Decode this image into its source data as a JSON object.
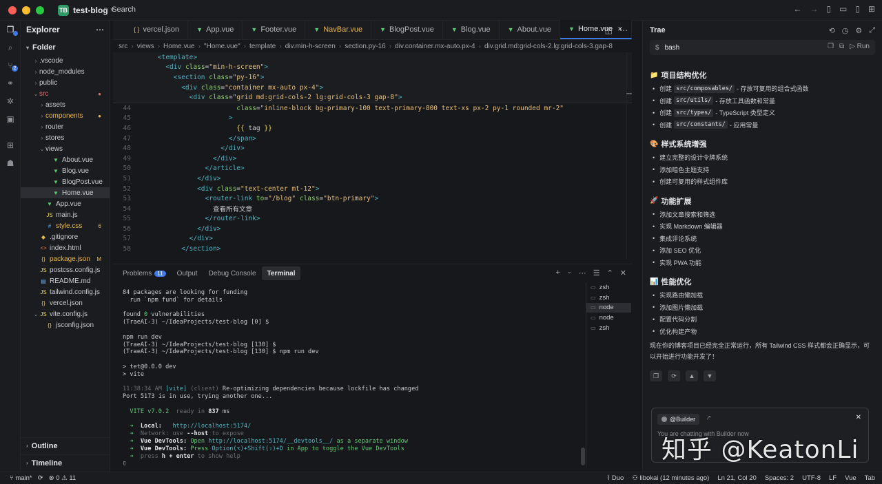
{
  "titlebar": {
    "badge": "TB",
    "project": "test-blog",
    "search_label": "Search"
  },
  "activity": {
    "scm_count": "2"
  },
  "explorer": {
    "title": "Explorer",
    "folder_title": "Folder",
    "tree": [
      {
        "label": ".vscode",
        "indent": 1,
        "type": "folder",
        "open": false
      },
      {
        "label": "node_modules",
        "indent": 1,
        "type": "folder",
        "open": false
      },
      {
        "label": "public",
        "indent": 1,
        "type": "folder",
        "open": false
      },
      {
        "label": "src",
        "indent": 1,
        "type": "folder",
        "open": true,
        "color": "#e66b6b",
        "badge": "●"
      },
      {
        "label": "assets",
        "indent": 2,
        "type": "folder",
        "open": false
      },
      {
        "label": "components",
        "indent": 2,
        "type": "folder",
        "open": false,
        "color": "#e8b84a",
        "badge": "●"
      },
      {
        "label": "router",
        "indent": 2,
        "type": "folder",
        "open": false
      },
      {
        "label": "stores",
        "indent": 2,
        "type": "folder",
        "open": false
      },
      {
        "label": "views",
        "indent": 2,
        "type": "folder",
        "open": true
      },
      {
        "label": "About.vue",
        "indent": 3,
        "type": "vue"
      },
      {
        "label": "Blog.vue",
        "indent": 3,
        "type": "vue"
      },
      {
        "label": "BlogPost.vue",
        "indent": 3,
        "type": "vue"
      },
      {
        "label": "Home.vue",
        "indent": 3,
        "type": "vue",
        "selected": true
      },
      {
        "label": "App.vue",
        "indent": 2,
        "type": "vue"
      },
      {
        "label": "main.js",
        "indent": 2,
        "type": "js"
      },
      {
        "label": "style.css",
        "indent": 2,
        "type": "css",
        "color": "#e8b84a",
        "badge": "6"
      },
      {
        "label": ".gitignore",
        "indent": 1,
        "type": "git"
      },
      {
        "label": "index.html",
        "indent": 1,
        "type": "html"
      },
      {
        "label": "package.json",
        "indent": 1,
        "type": "json",
        "color": "#e8b84a",
        "badge": "M"
      },
      {
        "label": "postcss.config.js",
        "indent": 1,
        "type": "js"
      },
      {
        "label": "README.md",
        "indent": 1,
        "type": "md"
      },
      {
        "label": "tailwind.config.js",
        "indent": 1,
        "type": "js"
      },
      {
        "label": "vercel.json",
        "indent": 1,
        "type": "json"
      },
      {
        "label": "vite.config.js",
        "indent": 1,
        "type": "js",
        "open": true,
        "chev": true
      },
      {
        "label": "jsconfig.json",
        "indent": 2,
        "type": "json"
      }
    ],
    "outline": "Outline",
    "timeline": "Timeline"
  },
  "editor": {
    "tabs": [
      {
        "label": "vercel.json",
        "icon": "{ }",
        "icon_color": "#e8c27a"
      },
      {
        "label": "App.vue",
        "icon": "▼",
        "icon_color": "#5ccc73"
      },
      {
        "label": "Footer.vue",
        "icon": "▼",
        "icon_color": "#5ccc73"
      },
      {
        "label": "NavBar.vue",
        "icon": "▼",
        "icon_color": "#5ccc73",
        "label_color": "#e8b84a"
      },
      {
        "label": "BlogPost.vue",
        "icon": "▼",
        "icon_color": "#5ccc73"
      },
      {
        "label": "Blog.vue",
        "icon": "▼",
        "icon_color": "#5ccc73"
      },
      {
        "label": "About.vue",
        "icon": "▼",
        "icon_color": "#5ccc73"
      },
      {
        "label": "Home.vue",
        "icon": "▼",
        "icon_color": "#5ccc73",
        "active": true
      }
    ],
    "breadcrumbs": [
      "src",
      "views",
      "Home.vue",
      "\"Home.vue\"",
      "template",
      "div.min-h-screen",
      "section.py-16",
      "div.container.mx-auto.px-4",
      "div.grid.md:grid-cols-2.lg:grid-cols-3.gap-8"
    ],
    "sticky_lines": [
      {
        "indent": 2,
        "parts": [
          [
            "tg",
            "<template>"
          ]
        ]
      },
      {
        "indent": 3,
        "parts": [
          [
            "tg",
            "<div "
          ],
          [
            "at",
            "class"
          ],
          [
            "pl",
            "="
          ],
          [
            "st",
            "\"min-h-screen\""
          ],
          [
            "tg",
            ">"
          ]
        ]
      },
      {
        "indent": 4,
        "parts": [
          [
            "tg",
            "<section "
          ],
          [
            "at",
            "class"
          ],
          [
            "pl",
            "="
          ],
          [
            "st",
            "\"py-16\""
          ],
          [
            "tg",
            ">"
          ]
        ]
      },
      {
        "indent": 5,
        "parts": [
          [
            "tg",
            "<div "
          ],
          [
            "at",
            "class"
          ],
          [
            "pl",
            "="
          ],
          [
            "st",
            "\"container mx-auto px-4\""
          ],
          [
            "tg",
            ">"
          ]
        ]
      },
      {
        "indent": 6,
        "parts": [
          [
            "tg",
            "<div "
          ],
          [
            "at",
            "class"
          ],
          [
            "pl",
            "="
          ],
          [
            "st",
            "\"grid md:grid-cols-2 lg:grid-cols-3 gap-8\""
          ],
          [
            "tg",
            ">"
          ]
        ]
      }
    ],
    "code_lines": [
      {
        "n": "44",
        "indent": 12,
        "parts": [
          [
            "at",
            "class"
          ],
          [
            "pl",
            "="
          ],
          [
            "st",
            "\"inline-block bg-primary-100 text-primary-800 text-xs px-2 py-1 rounded mr-2\""
          ]
        ]
      },
      {
        "n": "45",
        "indent": 11,
        "parts": [
          [
            "tg",
            ">"
          ]
        ]
      },
      {
        "n": "46",
        "indent": 12,
        "parts": [
          [
            "br",
            "{{ "
          ],
          [
            "pl",
            "tag"
          ],
          [
            "br",
            " }}"
          ]
        ]
      },
      {
        "n": "47",
        "indent": 11,
        "parts": [
          [
            "tg",
            "</span>"
          ]
        ]
      },
      {
        "n": "48",
        "indent": 10,
        "parts": [
          [
            "tg",
            "</div>"
          ]
        ]
      },
      {
        "n": "49",
        "indent": 9,
        "parts": [
          [
            "tg",
            "</div>"
          ]
        ]
      },
      {
        "n": "50",
        "indent": 8,
        "parts": [
          [
            "tg",
            "</article>"
          ]
        ]
      },
      {
        "n": "51",
        "indent": 7,
        "parts": [
          [
            "tg",
            "</div>"
          ]
        ]
      },
      {
        "n": "52",
        "indent": 7,
        "parts": [
          [
            "tg",
            "<div "
          ],
          [
            "at",
            "class"
          ],
          [
            "pl",
            "="
          ],
          [
            "st",
            "\"text-center mt-12\""
          ],
          [
            "tg",
            ">"
          ]
        ]
      },
      {
        "n": "53",
        "indent": 8,
        "parts": [
          [
            "tg",
            "<router-link "
          ],
          [
            "at",
            "to"
          ],
          [
            "pl",
            "="
          ],
          [
            "st",
            "\"/blog\" "
          ],
          [
            "at",
            "class"
          ],
          [
            "pl",
            "="
          ],
          [
            "st",
            "\"btn-primary\""
          ],
          [
            "tg",
            ">"
          ]
        ]
      },
      {
        "n": "54",
        "indent": 9,
        "parts": [
          [
            "pl",
            "查看所有文章"
          ]
        ]
      },
      {
        "n": "55",
        "indent": 8,
        "parts": [
          [
            "tg",
            "</router-link>"
          ]
        ]
      },
      {
        "n": "56",
        "indent": 7,
        "parts": [
          [
            "tg",
            "</div>"
          ]
        ]
      },
      {
        "n": "57",
        "indent": 6,
        "parts": [
          [
            "tg",
            "</div>"
          ]
        ]
      },
      {
        "n": "58",
        "indent": 5,
        "parts": [
          [
            "tg",
            "</section>"
          ]
        ]
      }
    ]
  },
  "panel": {
    "tabs": [
      "Problems",
      "Output",
      "Debug Console",
      "Terminal"
    ],
    "problems_count": "11",
    "sessions": [
      {
        "label": "zsh",
        "active": false
      },
      {
        "label": "zsh",
        "active": false
      },
      {
        "label": "node",
        "active": true
      },
      {
        "label": "node",
        "active": false
      },
      {
        "label": "zsh",
        "active": false
      }
    ],
    "terminal": [
      [
        [
          "",
          "84 packages are looking for funding"
        ]
      ],
      [
        [
          "",
          "  run `npm fund` for details"
        ]
      ],
      [
        [
          "",
          ""
        ]
      ],
      [
        [
          "",
          "found "
        ],
        [
          "green",
          "0"
        ],
        [
          "",
          " vulnerabilities"
        ]
      ],
      [
        [
          "",
          "(TraeAI-3) ~/IdeaProjects/test-blog [0] $"
        ]
      ],
      [
        [
          "",
          ""
        ]
      ],
      [
        [
          "",
          "npm run dev"
        ]
      ],
      [
        [
          "",
          "(TraeAI-3) ~/IdeaProjects/test-blog [130] $"
        ]
      ],
      [
        [
          "",
          "(TraeAI-3) ~/IdeaProjects/test-blog [130] $ npm run dev"
        ]
      ],
      [
        [
          "",
          ""
        ]
      ],
      [
        [
          "",
          "> tet@0.0.0 dev"
        ]
      ],
      [
        [
          "",
          "> vite"
        ]
      ],
      [
        [
          "",
          ""
        ]
      ],
      [
        [
          "dim",
          "11:38:34 AM "
        ],
        [
          "cyan",
          "[vite]"
        ],
        [
          "dim",
          " (client)"
        ],
        [
          "",
          " Re-optimizing dependencies because lockfile has changed"
        ]
      ],
      [
        [
          "",
          "Port 5173 is in use, trying another one..."
        ]
      ],
      [
        [
          "",
          ""
        ]
      ],
      [
        [
          "",
          "  "
        ],
        [
          "green",
          "VITE v7.0.2"
        ],
        [
          "dim",
          "  ready in "
        ],
        [
          "bold",
          "837"
        ],
        [
          "",
          " ms"
        ]
      ],
      [
        [
          "",
          ""
        ]
      ],
      [
        [
          "green",
          "  ➜  "
        ],
        [
          "bold",
          "Local:"
        ],
        [
          "cyan",
          "   http://localhost:5174/"
        ]
      ],
      [
        [
          "green",
          "  ➜  "
        ],
        [
          "dim",
          "Network: use "
        ],
        [
          "bold",
          "--host"
        ],
        [
          "dim",
          " to expose"
        ]
      ],
      [
        [
          "green",
          "  ➜  "
        ],
        [
          "bold",
          "Vue DevTools:"
        ],
        [
          "green",
          " Open "
        ],
        [
          "cyan",
          "http://localhost:5174/__devtools__/"
        ],
        [
          "green",
          " as a separate window"
        ]
      ],
      [
        [
          "green",
          "  ➜  "
        ],
        [
          "bold",
          "Vue DevTools:"
        ],
        [
          "green",
          " Press "
        ],
        [
          "cyan",
          "Option(⌥)+Shift(⇧)+D"
        ],
        [
          "green",
          " in App to toggle the Vue DevTools"
        ]
      ],
      [
        [
          "green",
          "  ➜  "
        ],
        [
          "dim",
          "press "
        ],
        [
          "bold",
          "h + enter"
        ],
        [
          "dim",
          " to show help"
        ]
      ],
      [
        [
          "",
          "▯"
        ]
      ]
    ]
  },
  "trae": {
    "title": "Trae",
    "bash_label": "bash",
    "run_label": "Run",
    "sections": [
      {
        "icon": "📁",
        "title": "项目结构优化",
        "items": [
          {
            "pre": "创建",
            "code": "src/composables/",
            "post": "- 存放可复用的组合式函数"
          },
          {
            "pre": "创建",
            "code": "src/utils/",
            "post": "- 存放工具函数和常量"
          },
          {
            "pre": "创建",
            "code": "src/types/",
            "post": "- TypeScript 类型定义"
          },
          {
            "pre": "创建",
            "code": "src/constants/",
            "post": "- 应用常量"
          }
        ]
      },
      {
        "icon": "🎨",
        "title": "样式系统增强",
        "items": [
          {
            "pre": "建立完整的设计令牌系统"
          },
          {
            "pre": "添加暗色主题支持"
          },
          {
            "pre": "创建可复用的样式组件库"
          }
        ]
      },
      {
        "icon": "🚀",
        "title": "功能扩展",
        "items": [
          {
            "pre": "添加文章搜索和筛选"
          },
          {
            "pre": "实现 Markdown 编辑器"
          },
          {
            "pre": "集成评论系统"
          },
          {
            "pre": "添加 SEO 优化"
          },
          {
            "pre": "实现 PWA 功能"
          }
        ]
      },
      {
        "icon": "📊",
        "title": "性能优化",
        "items": [
          {
            "pre": "实现路由懒加载"
          },
          {
            "pre": "添加图片懒加载"
          },
          {
            "pre": "配置代码分割"
          },
          {
            "pre": "优化构建产物"
          }
        ]
      }
    ],
    "summary": "现在你的博客项目已经完全正常运行，所有 Tailwind CSS 样式都会正确显示，可以开始进行功能开发了！",
    "builder_chip": "@Builder",
    "chat_placeholder": "You are chatting with Builder now",
    "watermark": "知乎 @KeatonLi"
  },
  "status": {
    "branch": "main*",
    "errors": "0",
    "warnings": "11",
    "duo": "Duo",
    "blame": "libokai (12 minutes ago)",
    "cursor": "Ln 21, Col 20",
    "spaces": "Spaces: 2",
    "encoding": "UTF-8",
    "eol": "LF",
    "lang": "Vue",
    "tab": "Tab"
  }
}
